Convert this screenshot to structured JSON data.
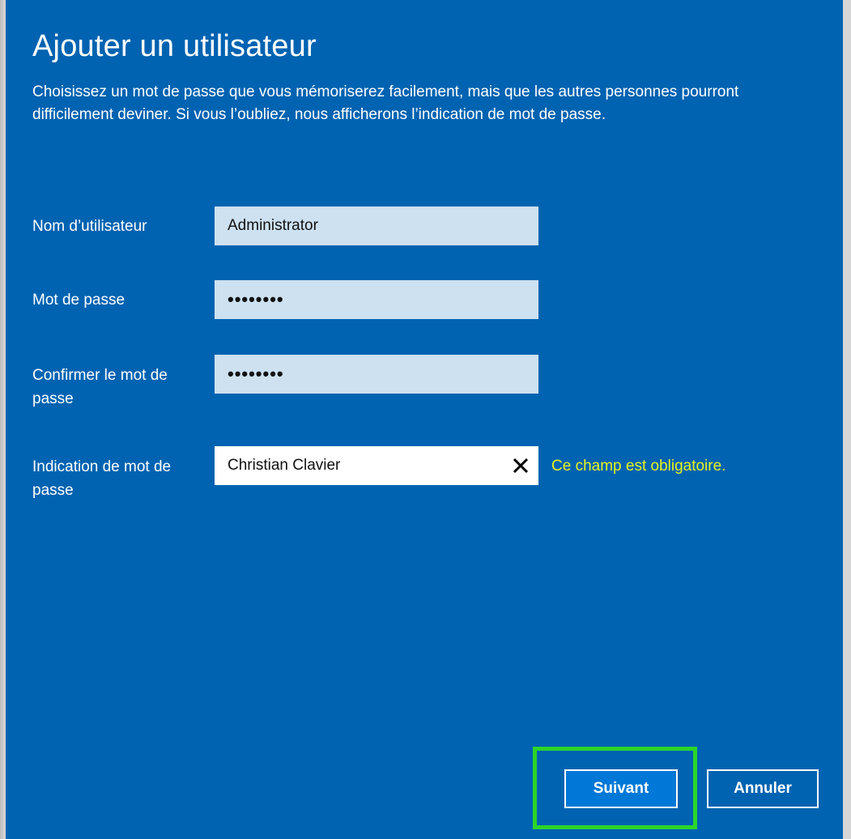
{
  "dialog": {
    "title": "Ajouter un utilisateur",
    "description": "Choisissez un mot de passe que vous mémoriserez facilement, mais que les autres personnes pourront difficilement deviner. Si vous l’oubliez, nous afficherons l’indication de mot de passe."
  },
  "form": {
    "username": {
      "label": "Nom d’utilisateur",
      "value": "Administrator"
    },
    "password": {
      "label": "Mot de passe",
      "value": "••••••••"
    },
    "confirm_password": {
      "label": "Confirmer le mot de passe",
      "value": "••••••••"
    },
    "hint": {
      "label": "Indication de mot de passe",
      "value": "Christian Clavier",
      "clear_icon": "close-icon",
      "error": "Ce champ est obligatoire."
    }
  },
  "buttons": {
    "next_label": "Suivant",
    "cancel_label": "Annuler"
  },
  "colors": {
    "dialog_background": "#0063b1",
    "input_background": "#cde1f0",
    "active_input_background": "#ffffff",
    "error_text": "#e6f41f",
    "primary_button": "#0078d7",
    "highlight_outline": "#2cd52a"
  }
}
